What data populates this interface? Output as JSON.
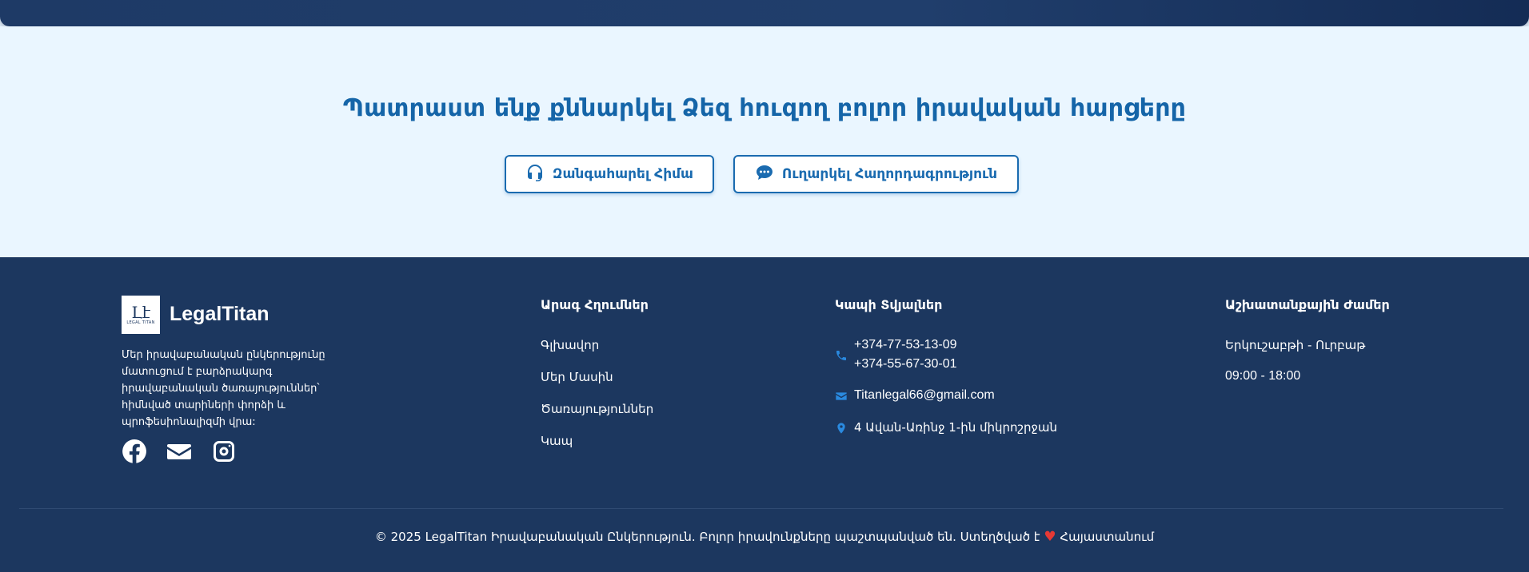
{
  "cta": {
    "title": "Պատրաստ ենք քննարկել Ձեզ հուզող բոլոր իրավական հարցերը",
    "call_label": "Զանգահարել Հիմա",
    "message_label": "Ուղարկել Հաղորդագրություն"
  },
  "footer": {
    "logo_mark": "Լէ",
    "logo_small": "LEGAL TITAN",
    "brand": "LegalTitan",
    "about": "Մեր իրավաբանական ընկերությունը մատուցում է բարձրակարգ իրավաբանական ծառայություններ՝ հիմնված տարիների փորձի և պրոֆեսիոնալիզմի վրա:",
    "socials": [
      "facebook-icon",
      "envelope-icon",
      "instagram-icon"
    ],
    "quick_links": {
      "title": "Արագ Հղումներ",
      "items": [
        "Գլխավոր",
        "Մեր Մասին",
        "Ծառայություններ",
        "Կապ"
      ]
    },
    "contact": {
      "title": "Կապի Տվյալներ",
      "phone1": "+374-77-53-13-09",
      "phone2": "+374-55-67-30-01",
      "email": "Titanlegal66@gmail.com",
      "address": "4 Ավան-Առինջ 1-ին միկրոշրջան"
    },
    "hours": {
      "title": "Աշխատանքային Ժամեր",
      "days": "Երկուշաբթի - Ուրբաթ",
      "time": "09:00 - 18:00"
    },
    "copyright": {
      "text": "© 2025 LegalTitan Իրավաբանական Ընկերություն. Բոլոր իրավունքները պաշտպանված են.",
      "made": "Ստեղծված է",
      "heart": "♥",
      "place": "Հայաստանում"
    }
  },
  "colors": {
    "accent": "#1565a8",
    "footer_bg": "#1c375f",
    "cta_bg": "#eaf6ff",
    "icon_blue": "#2a8ae0",
    "heart": "#e53935"
  }
}
